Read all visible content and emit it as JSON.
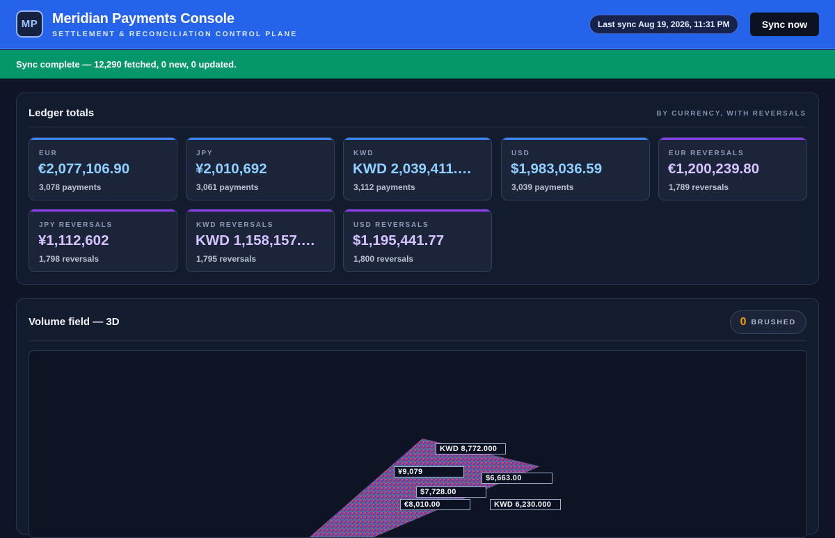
{
  "header": {
    "logo_text": "MP",
    "title": "Meridian Payments Console",
    "subtitle": "SETTLEMENT & RECONCILIATION CONTROL PLANE",
    "last_sync": "Last sync Aug 19, 2026, 11:31 PM",
    "sync_button": "Sync now"
  },
  "banner": {
    "message": "Sync complete — 12,290 fetched, 0 new, 0 updated.",
    "color": "#059669"
  },
  "ledger": {
    "title": "Ledger totals",
    "kicker": "BY CURRENCY, WITH REVERSALS",
    "cards": [
      {
        "label": "EUR",
        "value": "€2,077,106.90",
        "count": "3,078 payments",
        "kind": "payment"
      },
      {
        "label": "JPY",
        "value": "¥2,010,692",
        "count": "3,061 payments",
        "kind": "payment"
      },
      {
        "label": "KWD",
        "value": "KWD 2,039,411.…",
        "count": "3,112 payments",
        "kind": "payment"
      },
      {
        "label": "USD",
        "value": "$1,983,036.59",
        "count": "3,039 payments",
        "kind": "payment"
      },
      {
        "label": "EUR REVERSALS",
        "value": "€1,200,239.80",
        "count": "1,789 reversals",
        "kind": "reversal"
      },
      {
        "label": "JPY REVERSALS",
        "value": "¥1,112,602",
        "count": "1,798 reversals",
        "kind": "reversal"
      },
      {
        "label": "KWD REVERSALS",
        "value": "KWD 1,158,157.…",
        "count": "1,795 reversals",
        "kind": "reversal"
      },
      {
        "label": "USD REVERSALS",
        "value": "$1,195,441.77",
        "count": "1,800 reversals",
        "kind": "reversal"
      }
    ],
    "colors": {
      "payment": "#3b82f6",
      "reversal": "#8b3cf0"
    }
  },
  "volume": {
    "title": "Volume field — 3D",
    "brushed_count": "0",
    "brushed_label": "BRUSHED",
    "tags": [
      {
        "text": "KWD 8,772.000"
      },
      {
        "text": "¥9,079"
      },
      {
        "text": "$6,663.00"
      },
      {
        "text": "$7,728.00"
      },
      {
        "text": "€8,010.00"
      },
      {
        "text": "KWD 6,230.000"
      }
    ]
  }
}
